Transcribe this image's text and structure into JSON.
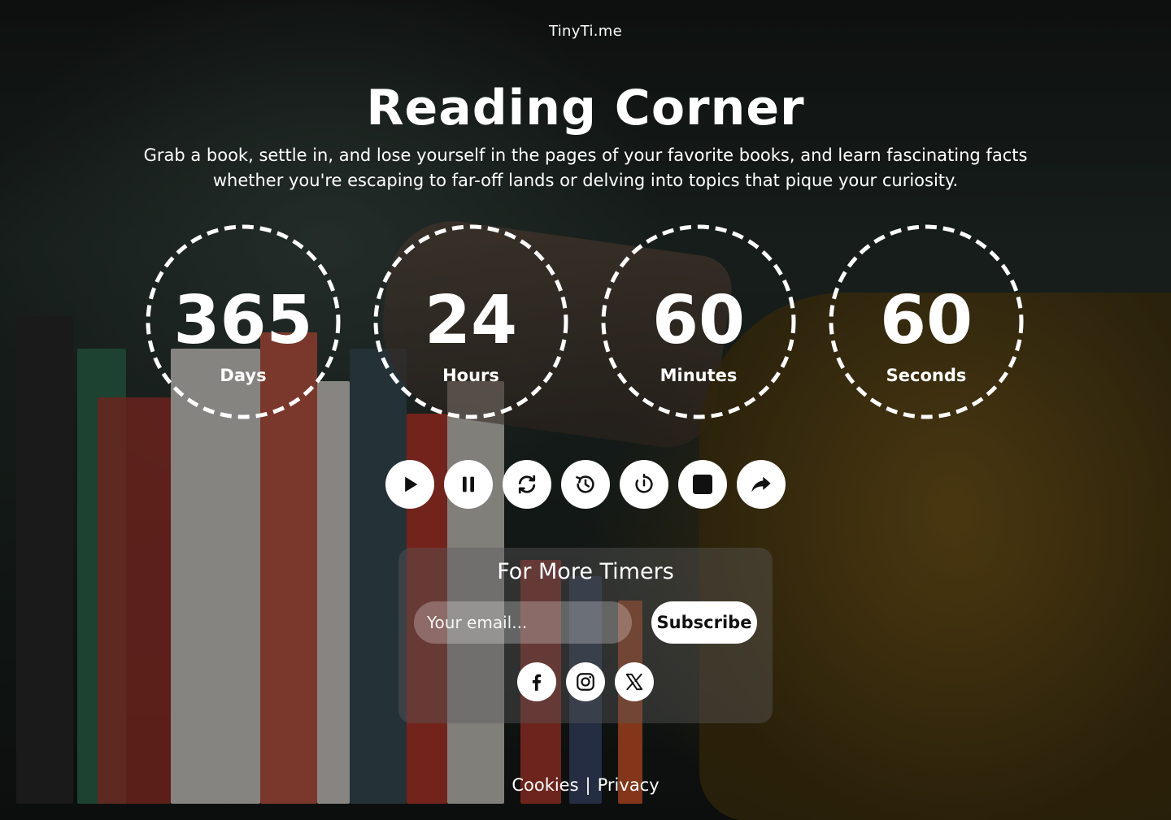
{
  "brand": "TinyTi.me",
  "title": "Reading Corner",
  "subtitle": "Grab a book, settle in, and lose yourself in the pages of your favorite books, and learn fascinating facts whether you're escaping to far-off lands or delving into topics that pique your curiosity.",
  "timers": [
    {
      "value": "365",
      "label": "Days"
    },
    {
      "value": "24",
      "label": "Hours"
    },
    {
      "value": "60",
      "label": "Minutes"
    },
    {
      "value": "60",
      "label": "Seconds"
    }
  ],
  "controls": [
    "play-icon",
    "pause-icon",
    "refresh-icon",
    "history-icon",
    "timer-icon",
    "stop-icon",
    "share-icon"
  ],
  "newsletter": {
    "title": "For More Timers",
    "email_placeholder": "Your email...",
    "subscribe_label": "Subscribe"
  },
  "socials": [
    "facebook-icon",
    "instagram-icon",
    "x-icon"
  ],
  "footer": {
    "cookies": "Cookies",
    "separator": "|",
    "privacy": "Privacy"
  },
  "colors": {
    "text": "#ffffff",
    "button_bg": "#ffffff",
    "icon": "#111111"
  }
}
